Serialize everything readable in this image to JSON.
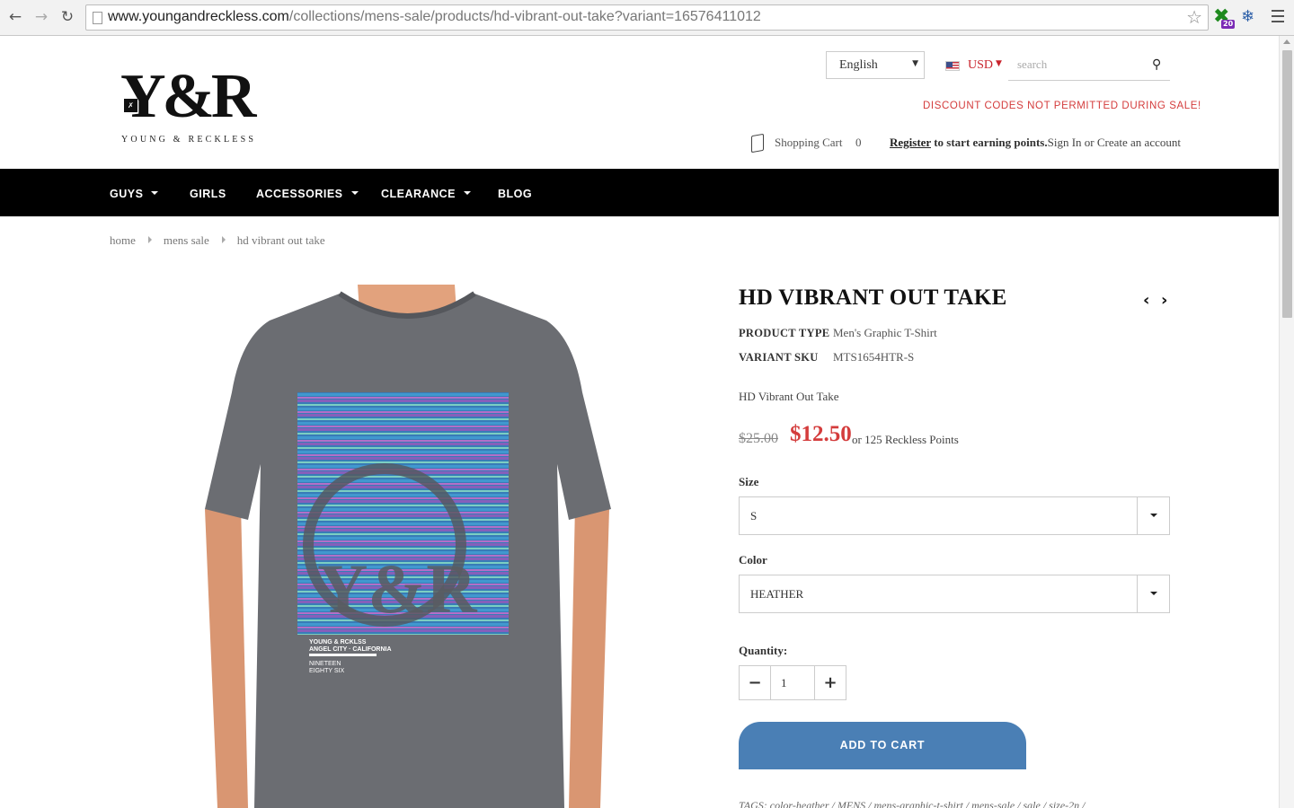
{
  "browser": {
    "url_domain": "www.youngandreckless.com",
    "url_path": "/collections/mens-sale/products/hd-vibrant-out-take?variant=16576411012",
    "back_icon": "arrow-left",
    "forward_icon": "arrow-right",
    "reload_icon": "reload",
    "bookmark_icon": "star",
    "ext_badge": "20"
  },
  "brand": {
    "logo_mark": "Y&R",
    "logo_tagline": "YOUNG & RECKLESS"
  },
  "header": {
    "language": "English",
    "currency": "USD",
    "search_placeholder": "search",
    "discount_note": "DISCOUNT CODES NOT PERMITTED DURING SALE!",
    "cart_label": "Shopping Cart",
    "cart_count": "0",
    "register_link": "Register",
    "register_text": " to start earning points.",
    "signin_text": "Sign In or Create an account"
  },
  "nav": {
    "items": [
      {
        "label": "GUYS",
        "dropdown": true
      },
      {
        "label": "GIRLS",
        "dropdown": false
      },
      {
        "label": "ACCESSORIES",
        "dropdown": true
      },
      {
        "label": "CLEARANCE",
        "dropdown": true
      },
      {
        "label": "BLOG",
        "dropdown": false
      }
    ]
  },
  "breadcrumb": [
    "home",
    "mens sale",
    "hd vibrant out take"
  ],
  "product": {
    "title": "HD VIBRANT OUT TAKE",
    "prev_icon": "chevron-left",
    "next_icon": "chevron-right",
    "product_type_label": "PRODUCT TYPE",
    "product_type": "Men's Graphic T-Shirt",
    "sku_label": "VARIANT SKU",
    "sku": "MTS1654HTR-S",
    "description": "HD Vibrant Out Take",
    "old_price": "$25.00",
    "price": "$12.50",
    "points": "or 125 Reckless Points",
    "size_label": "Size",
    "size_value": "S",
    "color_label": "Color",
    "color_value": "HEATHER",
    "quantity_label": "Quantity:",
    "quantity": "1",
    "add_to_cart": "ADD TO CART",
    "tags": "TAGS:   color-heather   /   MENS   /   mens-graphic-t-shirt   /   mens-sale   /   sale   /   size-2n   /",
    "image_print_lines": [
      "YOUNG & RCKLSS",
      "ANGEL CITY · CALIFORNIA",
      "NINETEEN",
      "EIGHTY SIX"
    ]
  },
  "colors": {
    "accent_red": "#d43c3c",
    "button_blue": "#4a7fb5",
    "nav_bg": "#000000"
  }
}
